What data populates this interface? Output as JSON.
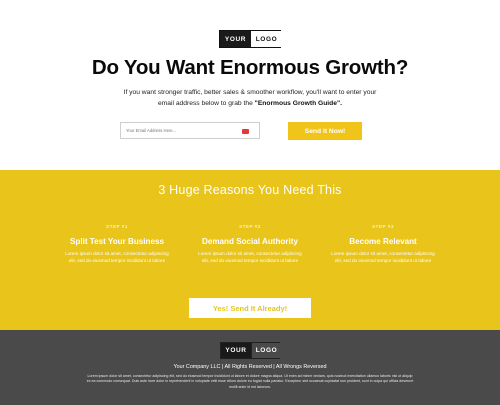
{
  "logo": {
    "left": "YOUR",
    "right": "LOGO"
  },
  "hero": {
    "headline": "Do You Want Enormous Growth?",
    "sub_line1": "If you want stronger traffic, better sales & smoother workflow, you'll want to enter your",
    "sub_line2_prefix": "email address below to grab the ",
    "sub_line2_bold": "\"Enormous Growth Guide\".",
    "email_placeholder": "Your Email Address Here...",
    "cta_label": "Send It Now!"
  },
  "reasons": {
    "heading": "3 Huge Reasons You Need This",
    "items": [
      {
        "step": "STEP #1",
        "title": "Split Test Your Business",
        "desc": "Lorem ipsum dolor sit amet, consectetur adipiscing elit, sed do eiusmod tempor incididunt ut labore"
      },
      {
        "step": "STEP #2",
        "title": "Demand Social Authority",
        "desc": "Lorem ipsum dolor sit amet, consectetur adipiscing elit, sed do eiusmod tempor incididunt ut labore"
      },
      {
        "step": "STEP #3",
        "title": "Become Relevant",
        "desc": "Lorem ipsum dolor sit amet, consectetur adipiscing elit, sed do eiusmod tempor incididunt ut labore"
      }
    ],
    "cta_label": "Yes! Send It Already!"
  },
  "footer": {
    "copyright": "Your Company LLC  |  All Rights Reserved  |  All Wrongs Reversed",
    "disclaimer": "Lorem ipsum dolor sit amet, consectetur adipiscing elit, sed do eiusmod tempor incididunt ut labore et dolore magna aliqua. Ut enim ad minim veniam, quis nostrud exercitation ullamco laboris nisi ut aliquip ex ea commodo consequat. Duis aute irure dolor in reprehenderit in voluptate velit esse cillum dolore eu fugiat nulla pariatur. Excepteur sint occaecat cupidatat non proident, sunt in culpa qui officia deserunt mollit anim id est laborum."
  },
  "colors": {
    "accent": "#e9c41a",
    "footer_bg": "#4a4a4a",
    "text_dark": "#111111"
  }
}
